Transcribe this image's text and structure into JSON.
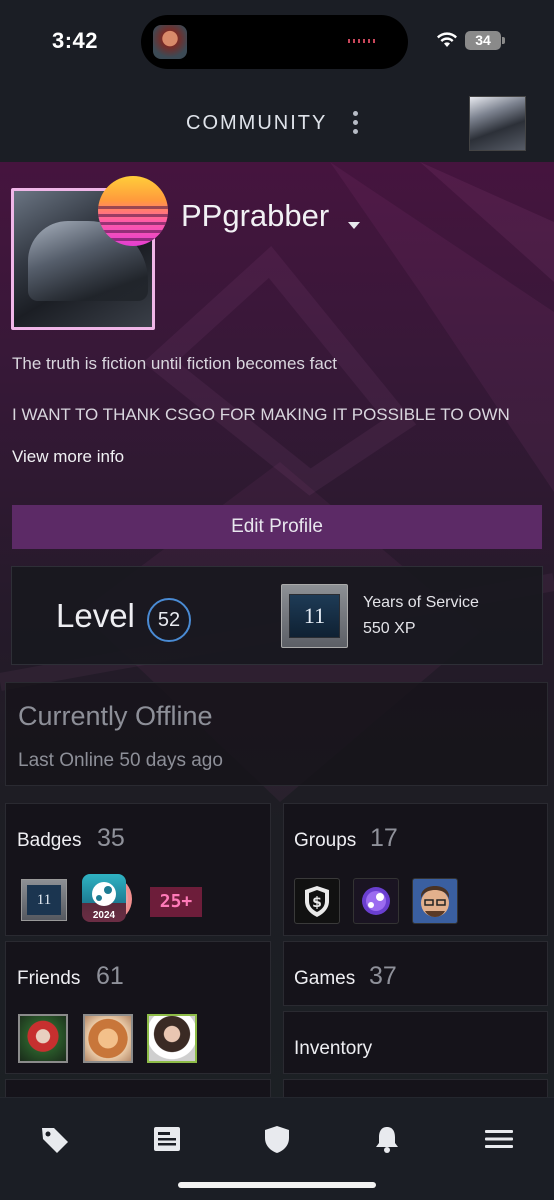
{
  "status_bar": {
    "time": "3:42",
    "battery": "34"
  },
  "header": {
    "title": "COMMUNITY"
  },
  "profile": {
    "username": "PPgrabber",
    "summary_line_1": "The truth is fiction until fiction becomes fact",
    "summary_line_2": "I WANT TO THANK CSGO FOR MAKING IT POSSIBLE TO OWN",
    "view_more": "View more info",
    "edit_button": "Edit Profile"
  },
  "level": {
    "label": "Level",
    "value": "52",
    "badge_number": "11",
    "badge_title": "Years of Service",
    "badge_xp": "550 XP"
  },
  "presence": {
    "status": "Currently Offline",
    "last_online": "Last Online 50 days ago"
  },
  "tiles": {
    "badges": {
      "label": "Badges",
      "count": "35",
      "items": [
        "11",
        "2024",
        "25+"
      ]
    },
    "groups": {
      "label": "Groups",
      "count": "17"
    },
    "friends": {
      "label": "Friends",
      "count": "61"
    },
    "games": {
      "label": "Games",
      "count": "37"
    },
    "inventory": {
      "label": "Inventory"
    }
  },
  "bottom_nav": [
    "store-tag-icon",
    "news-icon",
    "shield-icon",
    "bell-icon",
    "menu-icon"
  ],
  "colors": {
    "accent_purple": "#5c2a66",
    "level_ring": "#4a8bd4",
    "avatar_frame": "#f0b6e8"
  }
}
